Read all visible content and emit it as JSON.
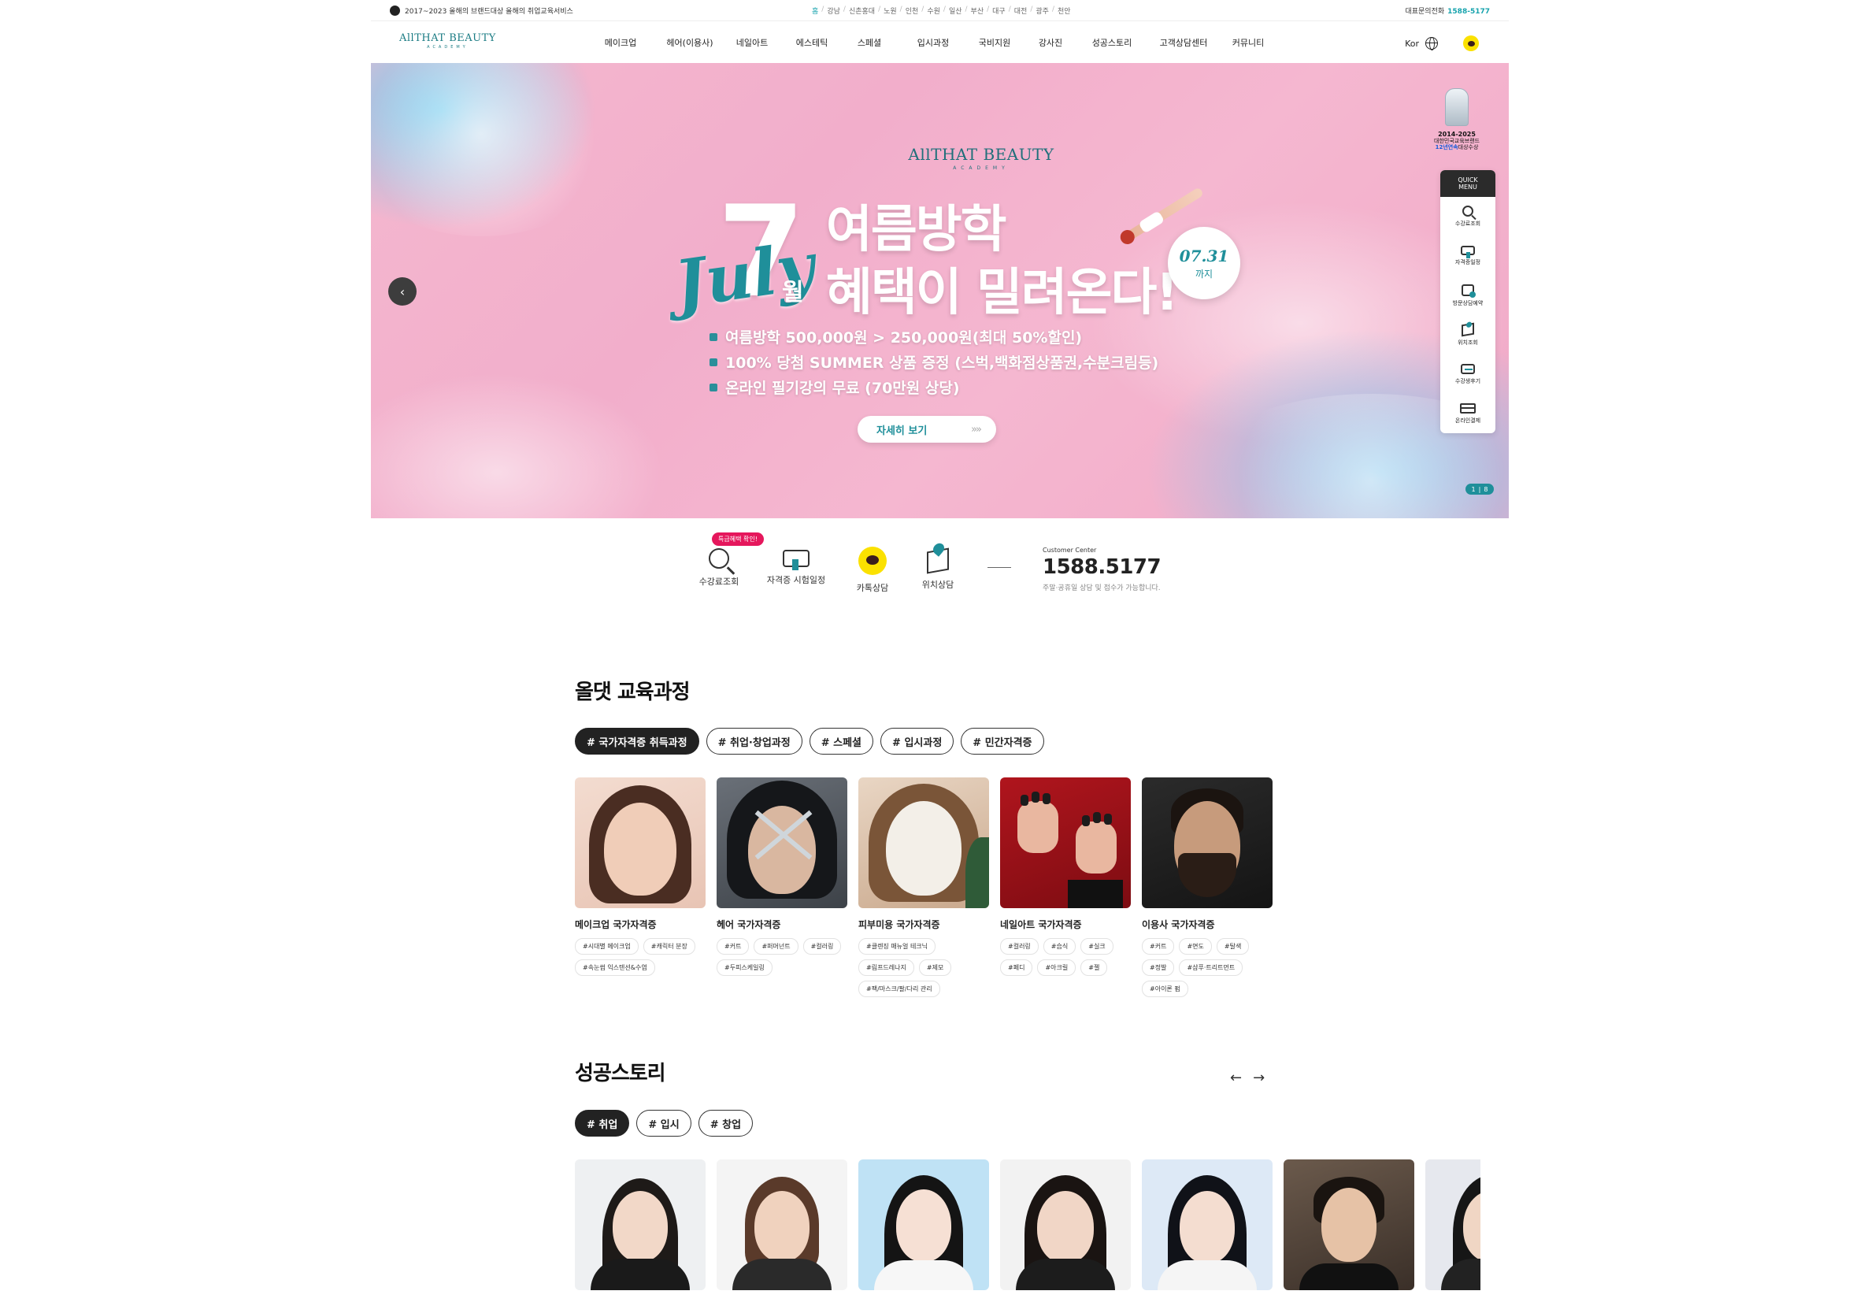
{
  "topbar": {
    "award_text": "2017~2023 올해의 브랜드대상 올해의 취업교육서비스",
    "branches": [
      "홈",
      "강남",
      "신촌홍대",
      "노원",
      "인천",
      "수원",
      "일산",
      "부산",
      "대구",
      "대전",
      "광주",
      "천안"
    ],
    "phone_label": "대표문의전화",
    "phone_number": "1588-5177"
  },
  "header": {
    "logo_text": "AllTHAT BEAUTY",
    "logo_sub": "ACADEMY",
    "nav": [
      "메이크업",
      "헤어(이용사)",
      "네일아트",
      "에스테틱",
      "스페셜",
      "입시과정",
      "국비지원",
      "강사진",
      "성공스토리",
      "고객상담센터",
      "커뮤니티"
    ],
    "lang": "Kor"
  },
  "hero": {
    "logo_text": "AllTHAT BEAUTY",
    "logo_sub": "ACADEMY",
    "big_number": "7",
    "script_text": "July",
    "month_text": "월",
    "headline_1": "여름방학",
    "headline_2": "혜택이 밀려온다!",
    "date_badge": "07.31",
    "date_badge_unit": "까지",
    "bullets": [
      "여름방학 500,000원 > 250,000원(최대 50%할인)",
      "100% 당첨 SUMMER 상품 증정 (스벅,백화점상품권,수분크림등)",
      "온라인 필기강의 무료 (70만원 상당)"
    ],
    "more_label": "자세히 보기",
    "more_arrows": "»»",
    "prev_arrow": "‹",
    "pager_current": "1",
    "pager_total": "8",
    "accent": "#1f8f9a"
  },
  "award_badge": {
    "years": "2014-2025",
    "line1": "대한민국교육브랜드",
    "line2_prefix": "12년연속",
    "line2_suffix": "대상수상"
  },
  "quick_menu": {
    "title_1": "QUICK",
    "title_2": "MENU",
    "items": [
      {
        "label": "수강료조회",
        "icon": "search-icon"
      },
      {
        "label": "자격증일정",
        "icon": "certificate-icon"
      },
      {
        "label": "방문상담예약",
        "icon": "calendar-icon"
      },
      {
        "label": "위치조회",
        "icon": "map-icon"
      },
      {
        "label": "수강생후기",
        "icon": "review-icon"
      },
      {
        "label": "온라인결제",
        "icon": "card-icon"
      }
    ]
  },
  "services": {
    "badge": "특급혜택 확인!",
    "items": [
      {
        "label": "수강료조회",
        "icon": "search-icon"
      },
      {
        "label": "자격증 시험일정",
        "icon": "certificate-icon"
      },
      {
        "label": "카톡상담",
        "icon": "kakao-icon"
      },
      {
        "label": "위치상담",
        "icon": "map-icon"
      }
    ],
    "cc_label": "Customer Center",
    "cc_number": "1588.5177",
    "cc_note": "주말·공휴일 상담 및 접수가 가능합니다."
  },
  "courses": {
    "title": "올댓 교육과정",
    "tabs": [
      "# 국가자격증 취득과정",
      "# 취업·창업과정",
      "# 스페셜",
      "# 입시과정",
      "# 민간자격증"
    ],
    "items": [
      {
        "name": "메이크업 국가자격증",
        "tags": [
          "#시대별 메이크업",
          "#캐릭터 분장",
          "#속눈썹 익스텐션&수염"
        ]
      },
      {
        "name": "헤어 국가자격증",
        "tags": [
          "#커트",
          "#퍼머넌트",
          "#컬러링",
          "#두피스케일링"
        ]
      },
      {
        "name": "피부미용 국가자격증",
        "tags": [
          "#클렌징 매뉴얼 테크닉",
          "#림프드레나지",
          "#제모",
          "#팩/마스크/팔/다리 관리"
        ]
      },
      {
        "name": "네일아트 국가자격증",
        "tags": [
          "#컬러링",
          "#습식",
          "#실크",
          "#페디",
          "#아크릴",
          "#젤"
        ]
      },
      {
        "name": "이용사 국가자격증",
        "tags": [
          "#커트",
          "#면도",
          "#탈색",
          "#정발",
          "#샴푸·트리트먼트",
          "#아이론 펌"
        ]
      }
    ]
  },
  "stories": {
    "title": "성공스토리",
    "tabs": [
      "# 취업",
      "# 입시",
      "# 창업"
    ],
    "prev": "←",
    "next": "→"
  }
}
